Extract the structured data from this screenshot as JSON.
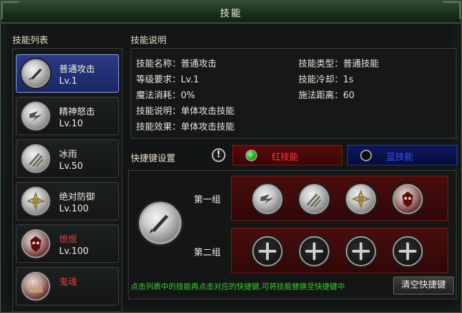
{
  "window": {
    "title": "技能"
  },
  "list": {
    "label": "技能列表",
    "items": [
      {
        "name": "普通攻击",
        "level": "Lv.1",
        "icon": "sword-icon",
        "style": "normal",
        "selected": true
      },
      {
        "name": "精神怒击",
        "level": "Lv.10",
        "icon": "lightning-strike-icon",
        "style": "normal",
        "selected": false
      },
      {
        "name": "冰雨",
        "level": "Lv.50",
        "icon": "ice-rain-icon",
        "style": "normal",
        "selected": false
      },
      {
        "name": "绝对防御",
        "level": "Lv.100",
        "icon": "spiral-shield-icon",
        "style": "normal",
        "selected": false
      },
      {
        "name": "愤恨",
        "level": "Lv.100",
        "icon": "demon-mask-icon",
        "style": "red",
        "selected": false
      },
      {
        "name": "鬼魂",
        "level": "",
        "icon": "ghost-claws-icon",
        "style": "red",
        "selected": false
      }
    ]
  },
  "description": {
    "label": "技能说明",
    "left": [
      {
        "key": "技能名称",
        "value": "普通攻击"
      },
      {
        "key": "等级要求",
        "value": "Lv.1"
      },
      {
        "key": "魔法消耗",
        "value": "0%"
      },
      {
        "key": "技能说明",
        "value": "单体攻击技能"
      },
      {
        "key": "技能效果",
        "value": "单体攻击技能"
      }
    ],
    "right": [
      {
        "key": "技能类型",
        "value": "普通技能"
      },
      {
        "key": "技能冷却",
        "value": "1s"
      },
      {
        "key": "施法距离",
        "value": "60"
      }
    ]
  },
  "hotkeys": {
    "label": "快捷键设置",
    "tabs": [
      {
        "label": "红技能",
        "active": true,
        "color": "#ff3b3b"
      },
      {
        "label": "蓝技能",
        "active": false,
        "color": "#2f56ff"
      }
    ],
    "groups": [
      {
        "label": "第一组",
        "slots": [
          "lightning-strike-icon",
          "ice-rain-icon",
          "spiral-shield-icon",
          "demon-mask-icon"
        ]
      },
      {
        "label": "第二组",
        "slots": [
          "plus-icon",
          "plus-icon",
          "plus-icon",
          "plus-icon"
        ]
      }
    ],
    "hint": "点击列表中的技能再点击对应的快捷键,可将技能替换至快捷键中",
    "clear_button": "清空快捷键"
  },
  "colors": {
    "title_green": "#1a301b",
    "selected_blue": "#2a3a86",
    "hint_green": "#35d12a",
    "red_text": "#e13b35"
  }
}
